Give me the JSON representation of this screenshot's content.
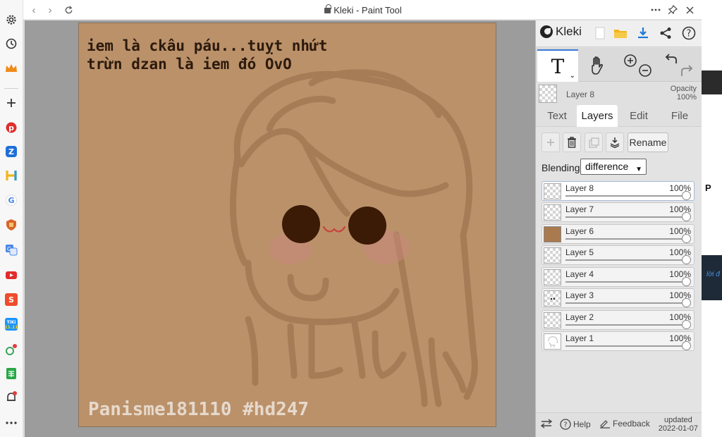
{
  "window": {
    "title": "Kleki - Paint Tool",
    "controls": {
      "more_icon": "ellipsis-icon",
      "pin_icon": "pin-icon",
      "close_icon": "close-icon"
    }
  },
  "browser_sidebar": {
    "icons": [
      "settings-icon",
      "history-icon",
      "crown-icon",
      "add-icon",
      "pinterest-icon",
      "zalo-icon",
      "h-app-icon",
      "google-icon",
      "shield-app-icon",
      "translate-icon",
      "youtube-icon",
      "shopee-icon",
      "tiki-icon",
      "lollipop-app-icon",
      "sheets-icon",
      "notification-icon",
      "more-icon"
    ]
  },
  "artwork": {
    "text_line1": "iem là ckâu páu...tuỵt nhứt",
    "text_line2": "trừn dzan là iem đó OvO",
    "watermark": "Panisme181110 #hd247"
  },
  "kleki": {
    "brand": "Kleki",
    "top_icons": [
      "new-file-icon",
      "open-folder-icon",
      "download-icon",
      "share-icon",
      "help-icon"
    ],
    "tools": {
      "text_tool": "T",
      "hand_icon": "hand-icon",
      "zoom_in_icon": "zoom-in-icon",
      "zoom_out_icon": "zoom-out-icon",
      "undo_icon": "undo-icon",
      "redo_icon": "redo-icon"
    },
    "current_layer": {
      "name": "Layer 8",
      "opacity_label": "Opacity",
      "opacity_value": "100%"
    },
    "tabs": [
      {
        "label": "Text"
      },
      {
        "label": "Layers",
        "active": true
      },
      {
        "label": "Edit"
      },
      {
        "label": "File"
      }
    ],
    "layer_actions": {
      "rename": "Rename"
    },
    "blending": {
      "label": "Blending",
      "value": "difference"
    },
    "layers": [
      {
        "name": "Layer 8",
        "opacity": "100%",
        "selected": true
      },
      {
        "name": "Layer 7",
        "opacity": "100%"
      },
      {
        "name": "Layer 6",
        "opacity": "100%"
      },
      {
        "name": "Layer 5",
        "opacity": "100%"
      },
      {
        "name": "Layer 4",
        "opacity": "100%"
      },
      {
        "name": "Layer 3",
        "opacity": "100%"
      },
      {
        "name": "Layer 2",
        "opacity": "100%"
      },
      {
        "name": "Layer 1",
        "opacity": "100%"
      }
    ],
    "footer": {
      "help": "Help",
      "feedback": "Feedback",
      "updated_label": "updated",
      "updated_date": "2022-01-07"
    }
  },
  "background_window": {
    "letter": "P",
    "link_fragment": "lời đ"
  },
  "colors": {
    "accent": "#3b7ad9",
    "canvas_bg": "#bb916a",
    "workspace": "#9c9c9c",
    "panel": "#e3e3e3"
  }
}
